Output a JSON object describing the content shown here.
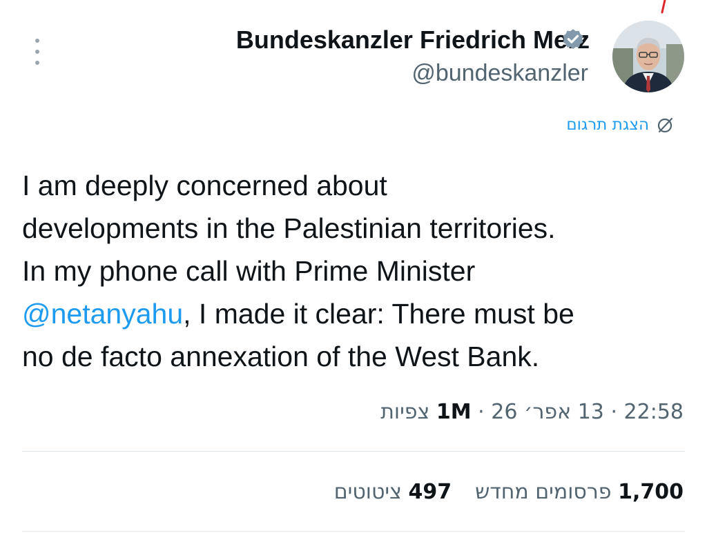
{
  "author": {
    "display_name": "Bundeskanzler Friedrich Merz",
    "handle": "@bundeskanzler",
    "verified_badge_color": "#829aab"
  },
  "translate": {
    "label": "הצגת תרגום",
    "icon": "globe-icon"
  },
  "tweet": {
    "line1": "I am deeply concerned about",
    "line2": "developments in the Palestinian territories.",
    "line3": "In my phone call with Prime Minister",
    "mention": "@netanyahu",
    "line4_rest": ", I made it clear: There must be",
    "line5": "no de facto annexation of the West Bank."
  },
  "meta": {
    "time": "22:58",
    "separator": "·",
    "date": "13 אפר׳ 26",
    "views_count": "1M",
    "views_label": "צפיות"
  },
  "stats": {
    "reposts_count": "1,700",
    "reposts_label": "פרסומים מחדש",
    "quotes_count": "497",
    "quotes_label": "ציטוטים"
  },
  "colors": {
    "link": "#1d9bf0",
    "secondary_text": "#536471",
    "primary_text": "#0f1419",
    "divider": "#e1e8ed"
  }
}
